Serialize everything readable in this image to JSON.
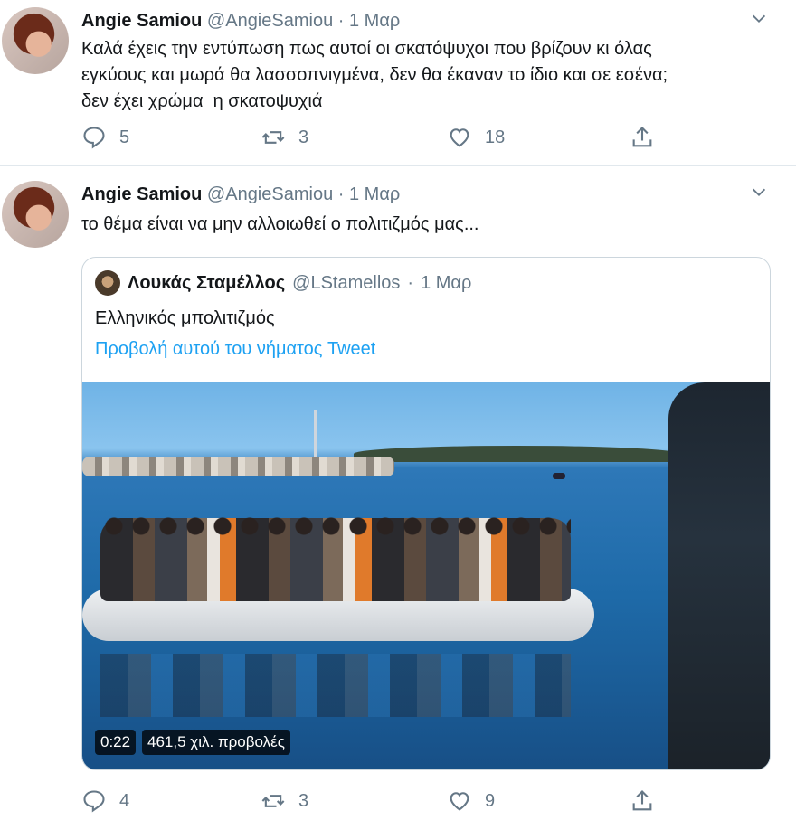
{
  "tweets": [
    {
      "name": "Angie Samiou",
      "handle": "@AngieSamiou",
      "dot": "·",
      "date": "1 Μαρ",
      "text": "Καλά έχεις την εντύπωση πως αυτοί οι σκατόψυχοι που βρίζουν κι όλας\nεγκύους και μωρά θα λασσοπνιγμένα, δεν θα έκαναν το ίδιο και σε εσένα;\nδεν έχει χρώμα  η σκατοψυχιά",
      "replies": "5",
      "retweets": "3",
      "likes": "18"
    },
    {
      "name": "Angie Samiou",
      "handle": "@AngieSamiou",
      "dot": "·",
      "date": "1 Μαρ",
      "text": "το θέμα είναι να μην αλλοιωθεί ο πολιτιζμός μας...",
      "replies": "4",
      "retweets": "3",
      "likes": "9",
      "quote": {
        "name": "Λουκάς Σταμέλλος",
        "handle": "@LStamellos",
        "dot": "·",
        "date": "1 Μαρ",
        "text": "Ελληνικός μπολιτιζμός",
        "link": "Προβολή αυτού του νήματος Tweet",
        "video": {
          "duration": "0:22",
          "views": "461,5 χιλ. προβολές"
        }
      }
    }
  ],
  "icons": [
    "chevron-down-icon",
    "reply-icon",
    "retweet-icon",
    "like-icon",
    "share-icon"
  ],
  "colors": {
    "link": "#1da1f2",
    "secondary_text": "#657786",
    "border": "#e1e8ed"
  }
}
